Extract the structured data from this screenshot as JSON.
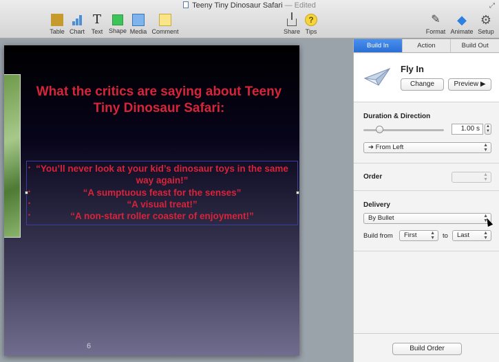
{
  "window": {
    "doc_title": "Teeny Tiny Dinosaur Safari",
    "edited_suffix": "— Edited"
  },
  "toolbar": {
    "table": "Table",
    "chart": "Chart",
    "text": "Text",
    "shape": "Shape",
    "media": "Media",
    "comment": "Comment",
    "share": "Share",
    "tips": "Tips",
    "format": "Format",
    "animate": "Animate",
    "setup": "Setup",
    "text_glyph": "T",
    "tips_glyph": "?",
    "format_glyph": "✎",
    "animate_glyph": "◆",
    "setup_glyph": "⚙"
  },
  "slide": {
    "title": "What the critics are saying about Teeny Tiny Dinosaur Safari:",
    "bullets": [
      "“You’ll never look at your kid’s dinosaur toys in the same way again!”",
      "“A sumptuous feast for the senses”",
      "“A visual treat!”",
      "“A non-start roller coaster of enjoyment!”"
    ],
    "bullet_glyph": "•",
    "slide_number": "6"
  },
  "inspector": {
    "tabs": [
      "Build In",
      "Action",
      "Build Out"
    ],
    "active_tab": "Build In",
    "effect_name": "Fly In",
    "change_label": "Change",
    "preview_label": "Preview ▶",
    "duration_heading": "Duration & Direction",
    "duration_value": "1.00 s",
    "duration_slider_level": 0.2,
    "direction_value": "➔  From Left",
    "order_heading": "Order",
    "delivery_heading": "Delivery",
    "delivery_value": "By Bullet",
    "build_from_label": "Build from",
    "build_from_value": "First",
    "to_label": "to",
    "build_to_value": "Last",
    "build_order_label": "Build Order",
    "stepper_up": "▲",
    "stepper_down": "▼",
    "select_arrows": "▲▼"
  },
  "colors": {
    "accent": "#2a6fd6",
    "slide_text": "#d8243a"
  }
}
